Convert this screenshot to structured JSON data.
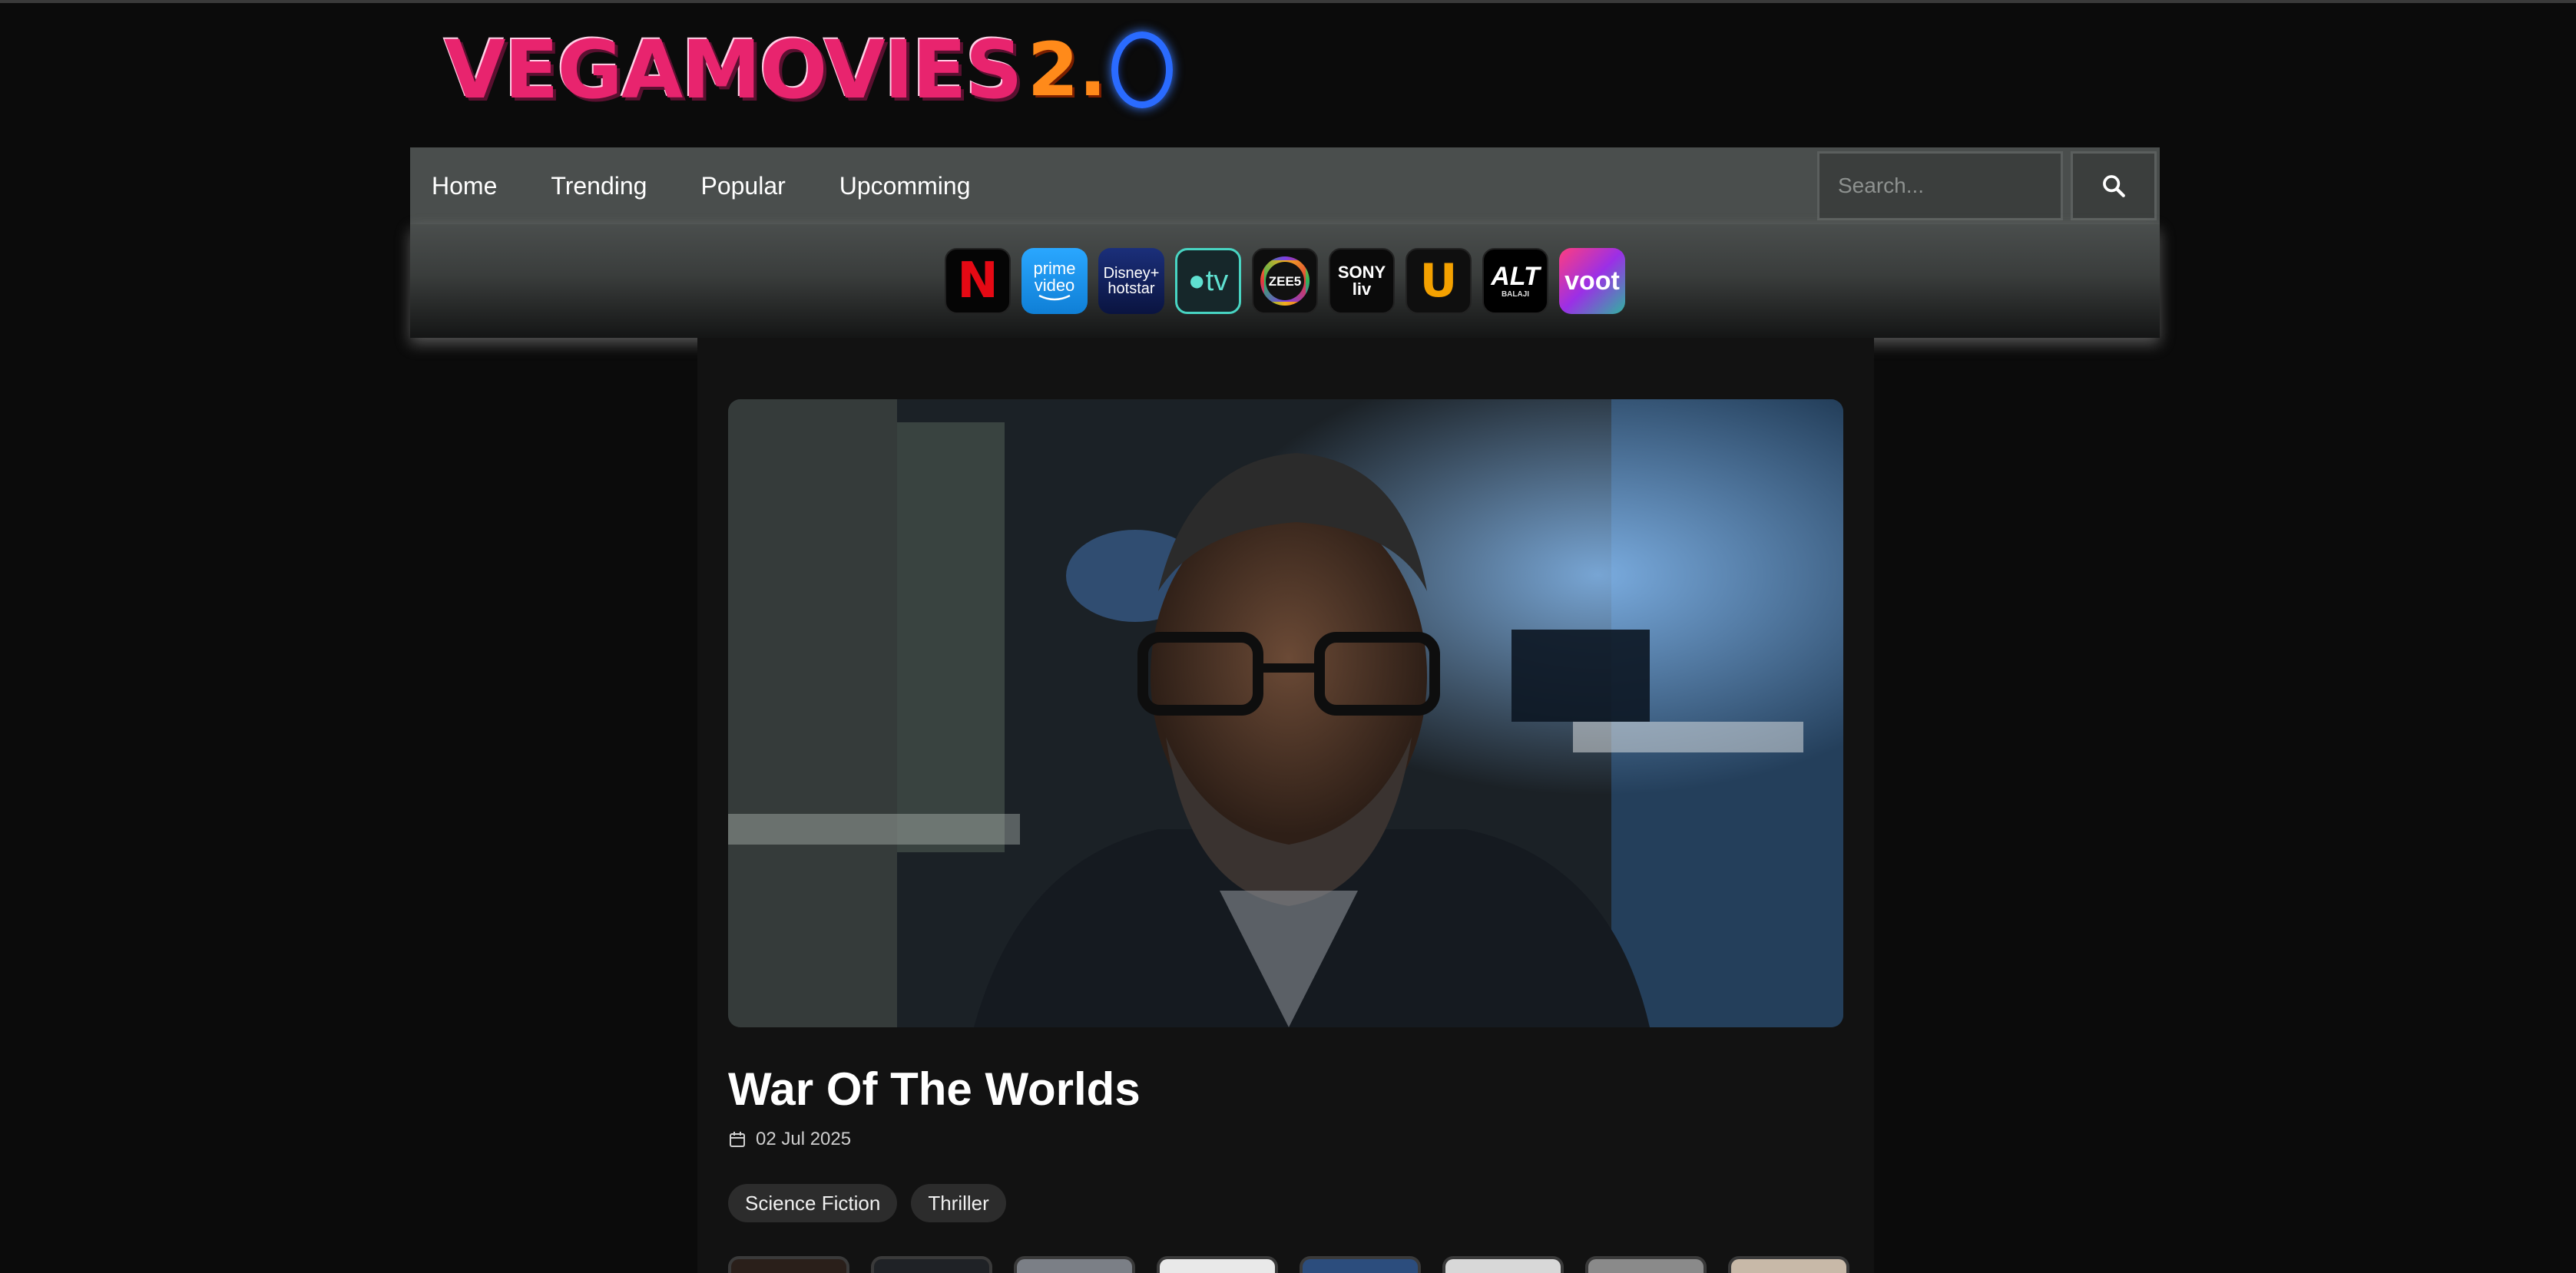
{
  "logo": {
    "text": "VEGAMOVIES",
    "suffix": "2.0"
  },
  "nav": {
    "items": [
      {
        "label": "Home"
      },
      {
        "label": "Trending"
      },
      {
        "label": "Popular"
      },
      {
        "label": "Upcomming"
      }
    ],
    "search": {
      "placeholder": "Search...",
      "icon": "search-icon"
    }
  },
  "platforms": [
    {
      "label": "N",
      "name": "netflix",
      "bg": "#000000",
      "fg": "#e50914"
    },
    {
      "label": "prime video",
      "name": "prime-video",
      "bg": "#1a98ff",
      "fg": "#ffffff"
    },
    {
      "label": "Disney+ hotstar",
      "name": "disney-hotstar",
      "bg": "#0c1a4a",
      "fg": "#ffffff"
    },
    {
      "label": "tv",
      "name": "apple-tv",
      "bg": "#1b2a2c",
      "fg": "#5fe0d0"
    },
    {
      "label": "ZEE5",
      "name": "zee5",
      "bg": "#111111",
      "fg": "#ffffff"
    },
    {
      "label": "SONY liv",
      "name": "sony-liv",
      "bg": "#0b0b0b",
      "fg": "#ffffff"
    },
    {
      "label": "U",
      "name": "ullu",
      "bg": "#111111",
      "fg": "#f4a100"
    },
    {
      "label": "ALT",
      "name": "alt-balaji",
      "bg": "#000000",
      "fg": "#ffffff",
      "sub": "BALAJI"
    },
    {
      "label": "voot",
      "name": "voot",
      "bg": "#8a2be2",
      "fg": "#ffffff"
    }
  ],
  "movie": {
    "title": "War Of The Worlds",
    "date": "02 Jul 2025",
    "genres": [
      "Science Fiction",
      "Thriller"
    ]
  }
}
